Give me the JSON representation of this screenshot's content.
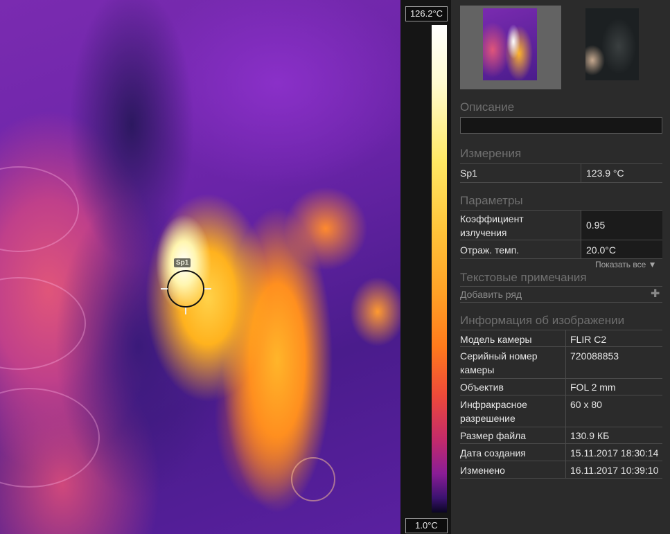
{
  "thermal": {
    "spot_label": "Sp1"
  },
  "scale": {
    "max": "126.2°C",
    "min": "1.0°C"
  },
  "panel": {
    "description": {
      "title": "Описание",
      "value": ""
    },
    "measurements": {
      "title": "Измерения",
      "rows": [
        {
          "name": "Sp1",
          "value": "123.9 °C"
        }
      ]
    },
    "parameters": {
      "title": "Параметры",
      "rows": [
        {
          "name_line1": "Коэффициент",
          "name_line2": "излучения",
          "value": "0.95"
        },
        {
          "name_line1": "Отраж. темп.",
          "value": "20.0°C"
        }
      ],
      "show_all": "Показать все"
    },
    "notes": {
      "title": "Текстовые примечания",
      "add_row": "Добавить ряд"
    },
    "image_info": {
      "title": "Информация об изображении",
      "rows": [
        {
          "name_line1": "Модель камеры",
          "value": "FLIR C2"
        },
        {
          "name_line1": "Серийный номер",
          "name_line2": "камеры",
          "value": "720088853"
        },
        {
          "name_line1": "Объектив",
          "value": "FOL 2 mm"
        },
        {
          "name_line1": "Инфракрасное",
          "name_line2": "разрешение",
          "value": "60 x 80"
        },
        {
          "name_line1": "Размер файла",
          "value": "130.9 КБ"
        },
        {
          "name_line1": "Дата создания",
          "value": "15.11.2017 18:30:14"
        },
        {
          "name_line1": "Изменено",
          "value": "16.11.2017 10:39:10"
        }
      ]
    }
  }
}
